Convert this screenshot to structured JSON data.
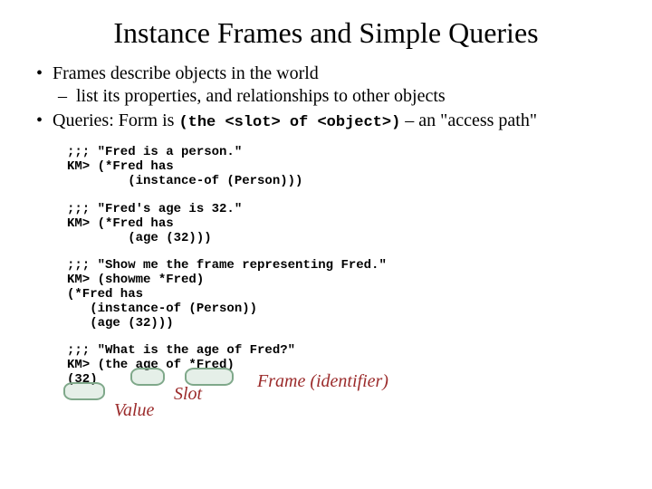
{
  "title": "Instance Frames and Simple Queries",
  "bullets": {
    "b1": "Frames describe objects in the world",
    "b1_sub": "list its properties, and relationships to other objects",
    "b2_pre": "Queries: Form is ",
    "b2_code": "(the <slot> of <object>)",
    "b2_post": " – an \"access path\""
  },
  "code": {
    "block1": ";;; \"Fred is a person.\"\nKM> (*Fred has\n        (instance-of (Person)))",
    "block2": ";;; \"Fred's age is 32.\"\nKM> (*Fred has\n        (age (32)))",
    "block3": ";;; \"Show me the frame representing Fred.\"\nKM> (showme *Fred)\n(*Fred has\n   (instance-of (Person))\n   (age (32)))",
    "block4": ";;; \"What is the age of Fred?\"\nKM> (the age of *Fred)\n(32)"
  },
  "annotations": {
    "slot": "Slot",
    "frame": "Frame (identifier)",
    "value": "Value"
  }
}
